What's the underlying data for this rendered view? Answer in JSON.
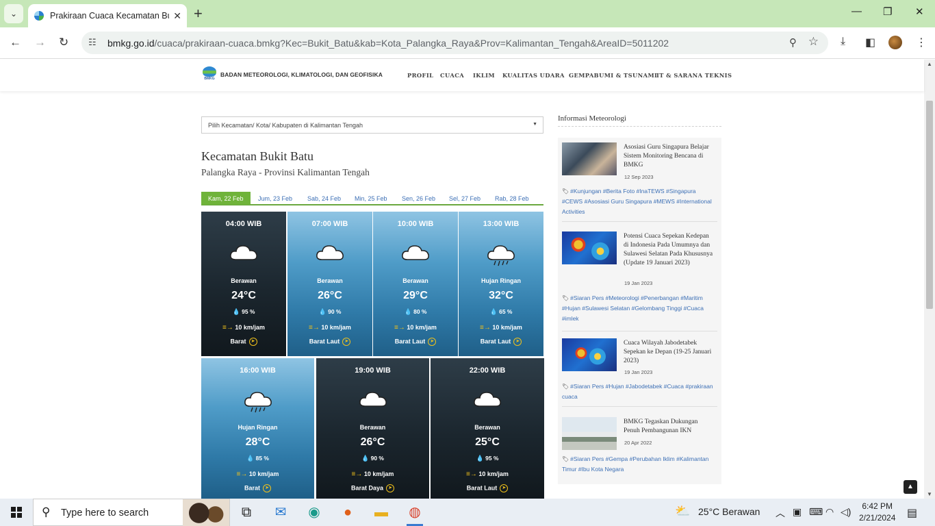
{
  "browser": {
    "tab_title": "Prakiraan Cuaca Kecamatan Bukit",
    "url_domain": "bmkg.go.id",
    "url_path": "/cuaca/prakiraan-cuaca.bmkg?Kec=Bukit_Batu&kab=Kota_Palangka_Raya&Prov=Kalimantan_Tengah&AreaID=5011202"
  },
  "site": {
    "org_name": "BADAN METEOROLOGI, KLIMATOLOGI, DAN GEOFISIKA",
    "logo_text": "BMKG",
    "menu": [
      "PROFIL",
      "CUACA",
      "IKLIM",
      "KUALITAS UDARA",
      "GEMPABUMI & TSUNAMI",
      "IT & SARANA TEKNIS"
    ]
  },
  "main": {
    "select_placeholder": "Pilih Kecamatan/ Kota/ Kabupaten di Kalimantan Tengah",
    "title": "Kecamatan Bukit Batu",
    "subtitle": "Palangka Raya - Provinsi Kalimantan Tengah",
    "day_tabs": [
      "Kam, 22 Feb",
      "Jum, 23 Feb",
      "Sab, 24 Feb",
      "Min, 25 Feb",
      "Sen, 26 Feb",
      "Sel, 27 Feb",
      "Rab, 28 Feb"
    ],
    "forecasts": [
      {
        "time": "04:00 WIB",
        "desc": "Berawan",
        "temp": "24°C",
        "humidity": "95 %",
        "wind": "10 km/jam",
        "dir": "Barat",
        "theme": "dark",
        "icon": "cloud-icon"
      },
      {
        "time": "07:00 WIB",
        "desc": "Berawan",
        "temp": "26°C",
        "humidity": "90 %",
        "wind": "10 km/jam",
        "dir": "Barat Laut",
        "theme": "blue",
        "icon": "cloud-icon"
      },
      {
        "time": "10:00 WIB",
        "desc": "Berawan",
        "temp": "29°C",
        "humidity": "80 %",
        "wind": "10 km/jam",
        "dir": "Barat Laut",
        "theme": "blue",
        "icon": "cloud-icon"
      },
      {
        "time": "13:00 WIB",
        "desc": "Hujan Ringan",
        "temp": "32°C",
        "humidity": "65 %",
        "wind": "10 km/jam",
        "dir": "Barat Laut",
        "theme": "blue",
        "icon": "rain-cloud-icon"
      },
      {
        "time": "16:00 WIB",
        "desc": "Hujan Ringan",
        "temp": "28°C",
        "humidity": "85 %",
        "wind": "10 km/jam",
        "dir": "Barat",
        "theme": "blue",
        "icon": "rain-cloud-icon"
      },
      {
        "time": "19:00 WIB",
        "desc": "Berawan",
        "temp": "26°C",
        "humidity": "90 %",
        "wind": "10 km/jam",
        "dir": "Barat Daya",
        "theme": "dark",
        "icon": "cloud-icon"
      },
      {
        "time": "22:00 WIB",
        "desc": "Berawan",
        "temp": "25°C",
        "humidity": "95 %",
        "wind": "10 km/jam",
        "dir": "Barat Laut",
        "theme": "dark",
        "icon": "cloud-icon"
      }
    ]
  },
  "sidebar": {
    "title": "Informasi Meteorologi",
    "news": [
      {
        "title": "Asosiasi Guru Singapura Belajar Sistem Monitoring Bencana di BMKG",
        "date": "12 Sep 2023",
        "tags": "#Kunjungan #Berita Foto #InaTEWS #Singapura #CEWS #Asosiasi Guru Singapura #MEWS #International Activities"
      },
      {
        "title": "Potensi Cuaca Sepekan Kedepan di Indonesia Pada Umumnya dan Sulawesi Selatan Pada Khususnya (Update 19 Januari 2023)",
        "date": "19 Jan 2023",
        "tags": "#Siaran Pers #Meteorologi #Penerbangan #Maritim #Hujan #Sulawesi Selatan #Gelombang Tinggi #Cuaca #imlek"
      },
      {
        "title": "Cuaca Wilayah Jabodetabek Sepekan ke Depan (19-25 Januari 2023)",
        "date": "19 Jan 2023",
        "tags": "#Siaran Pers #Hujan #Jabodetabek #Cuaca #prakiraan cuaca"
      },
      {
        "title": "BMKG Tegaskan Dukungan Penuh Pembangunan IKN",
        "date": "20 Apr 2022",
        "tags": "#Siaran Pers #Gempa #Perubahan Iklim #Kalimantan Timur #Ibu Kota Negara"
      }
    ]
  },
  "taskbar": {
    "search_placeholder": "Type here to search",
    "weather": "25°C  Berawan",
    "time": "6:42 PM",
    "date": "2/21/2024"
  }
}
